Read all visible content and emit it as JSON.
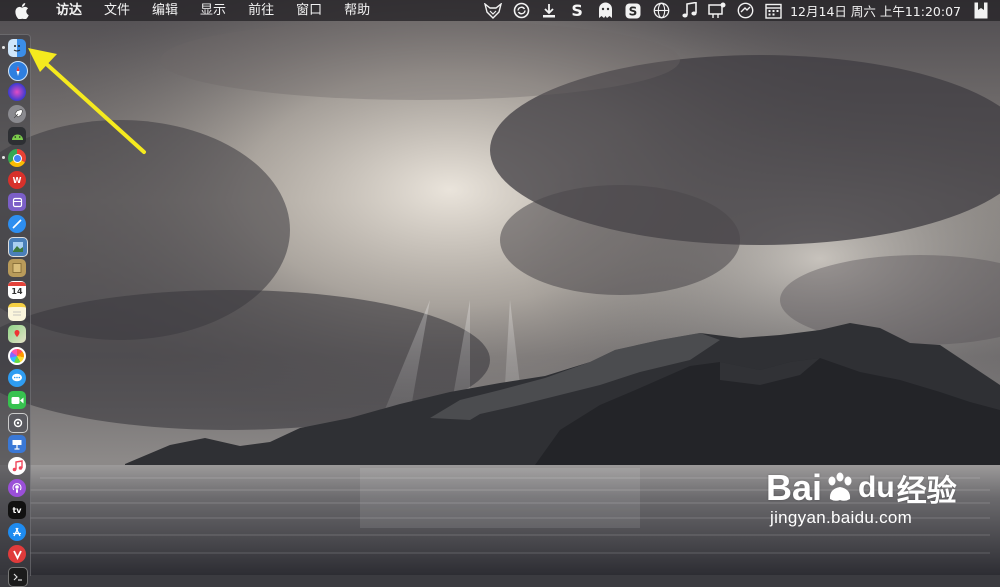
{
  "menubar": {
    "apple_icon": "apple-icon",
    "items": [
      {
        "label": "访达",
        "bold": true
      },
      {
        "label": "文件"
      },
      {
        "label": "编辑"
      },
      {
        "label": "显示"
      },
      {
        "label": "前往"
      },
      {
        "label": "窗口"
      },
      {
        "label": "帮助"
      }
    ],
    "status_icons": [
      "fox-icon",
      "sync-icon",
      "download-icon",
      "s-icon",
      "ghost-icon",
      "s-box-icon",
      "globe-icon",
      "music-note-icon",
      "notification-icon",
      "share-icon",
      "calendar-icon"
    ],
    "clock": "12月14日 周六 上午11:20:07",
    "last_icon": "bookmark-icon"
  },
  "dock": {
    "items": [
      {
        "name": "finder",
        "icon": "finder-icon",
        "color": "#3b8ee8",
        "running": true
      },
      {
        "name": "safari",
        "icon": "safari-icon",
        "color": "#2f7fe0",
        "running": false
      },
      {
        "name": "siri",
        "icon": "siri-icon",
        "color": "#6a4de0",
        "running": false
      },
      {
        "name": "launchpad",
        "icon": "rocket-icon",
        "color": "#8a8a8f",
        "running": false
      },
      {
        "name": "android-studio",
        "icon": "android-icon",
        "color": "#4caf50",
        "running": false
      },
      {
        "name": "chrome",
        "icon": "chrome-icon",
        "color": "#e94235",
        "running": true
      },
      {
        "name": "wps",
        "icon": "wps-icon",
        "color": "#d8312b",
        "running": false
      },
      {
        "name": "music-editor",
        "icon": "purple-app-icon",
        "color": "#7b5fc7",
        "running": false
      },
      {
        "name": "browser",
        "icon": "compass-icon",
        "color": "#2d8ef0",
        "running": false
      },
      {
        "name": "preview",
        "icon": "preview-icon",
        "color": "#4a7fb8",
        "running": false
      },
      {
        "name": "notebook",
        "icon": "notebook-icon",
        "color": "#b99b5a",
        "running": false
      },
      {
        "name": "calendar",
        "icon": "calendar-icon",
        "color": "#ffffff",
        "label": "14",
        "running": false
      },
      {
        "name": "notes",
        "icon": "notes-icon",
        "color": "#f7e27a",
        "running": false
      },
      {
        "name": "maps",
        "icon": "maps-icon",
        "color": "#5fbf6b",
        "running": false
      },
      {
        "name": "photos",
        "icon": "photos-icon",
        "color": "#f0a23b",
        "running": false
      },
      {
        "name": "messages",
        "icon": "message-bubble-icon",
        "color": "#2f9df2",
        "running": false
      },
      {
        "name": "facetime",
        "icon": "facetime-icon",
        "color": "#37c24f",
        "running": false
      },
      {
        "name": "screenshot",
        "icon": "screenshot-icon",
        "color": "#5a5a60",
        "running": false
      },
      {
        "name": "keynote",
        "icon": "keynote-icon",
        "color": "#3a78d6",
        "running": false
      },
      {
        "name": "music",
        "icon": "music-icon",
        "color": "#f0475c",
        "running": false
      },
      {
        "name": "podcasts",
        "icon": "podcasts-icon",
        "color": "#9a4fd8",
        "running": false
      },
      {
        "name": "tv",
        "icon": "tv-icon",
        "color": "#111111",
        "label": "tv",
        "running": false
      },
      {
        "name": "app-store",
        "icon": "app-store-icon",
        "color": "#1e8bf0",
        "running": false
      },
      {
        "name": "vivaldi",
        "icon": "vivaldi-icon",
        "color": "#e03b3b",
        "running": false
      },
      {
        "name": "terminal",
        "icon": "terminal-icon",
        "color": "#1b1b1b",
        "running": false
      }
    ]
  },
  "annotation": {
    "arrow_color": "#f5ea1e"
  },
  "watermark": {
    "logo_text": "Bai",
    "logo_text2": "du",
    "logo_cn": "经验",
    "url": "jingyan.baidu.com"
  }
}
